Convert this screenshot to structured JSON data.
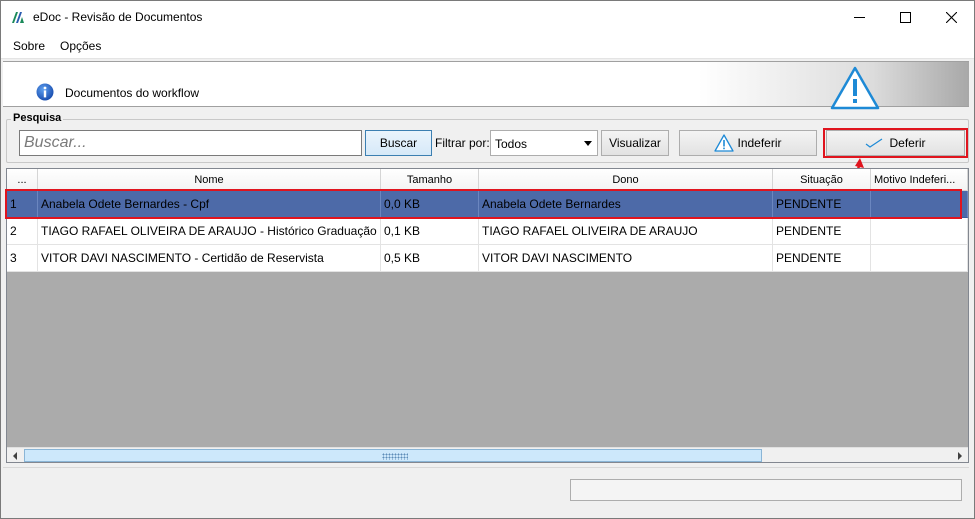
{
  "window": {
    "title": "eDoc - Revisão de Documentos",
    "minimize_icon": "minimize-icon",
    "maximize_icon": "maximize-icon",
    "close_icon": "close-icon"
  },
  "menu": {
    "items": [
      "Sobre",
      "Opções"
    ]
  },
  "header": {
    "text": "Documentos do workflow",
    "info_icon": "info-icon",
    "warning_icon": "warning-icon"
  },
  "search": {
    "group_label": "Pesquisa",
    "placeholder": "Buscar...",
    "value": "",
    "search_button": "Buscar",
    "filter_label": "Filtrar por:",
    "filter_value": "Todos",
    "view_button": "Visualizar",
    "reject_button": "Indeferir",
    "approve_button": "Deferir"
  },
  "table": {
    "columns": [
      "...",
      "Nome",
      "Tamanho",
      "Dono",
      "Situação",
      "Motivo Indeferi..."
    ],
    "rows": [
      {
        "index": "1",
        "nome": "Anabela Odete Bernardes - Cpf",
        "tamanho": "0,0 KB",
        "dono": "Anabela Odete Bernardes",
        "situacao": "PENDENTE",
        "motivo": ""
      },
      {
        "index": "2",
        "nome": "TIAGO RAFAEL OLIVEIRA DE ARAUJO - Histórico Graduação",
        "tamanho": "0,1 KB",
        "dono": "TIAGO RAFAEL OLIVEIRA DE ARAUJO",
        "situacao": "PENDENTE",
        "motivo": ""
      },
      {
        "index": "3",
        "nome": "VITOR DAVI NASCIMENTO - Certidão de Reservista",
        "tamanho": "0,5 KB",
        "dono": "VITOR DAVI NASCIMENTO",
        "situacao": "PENDENTE",
        "motivo": ""
      }
    ],
    "selected_row": 1
  },
  "colors": {
    "selection": "#4d6aa8",
    "highlight": "#e0141e"
  }
}
